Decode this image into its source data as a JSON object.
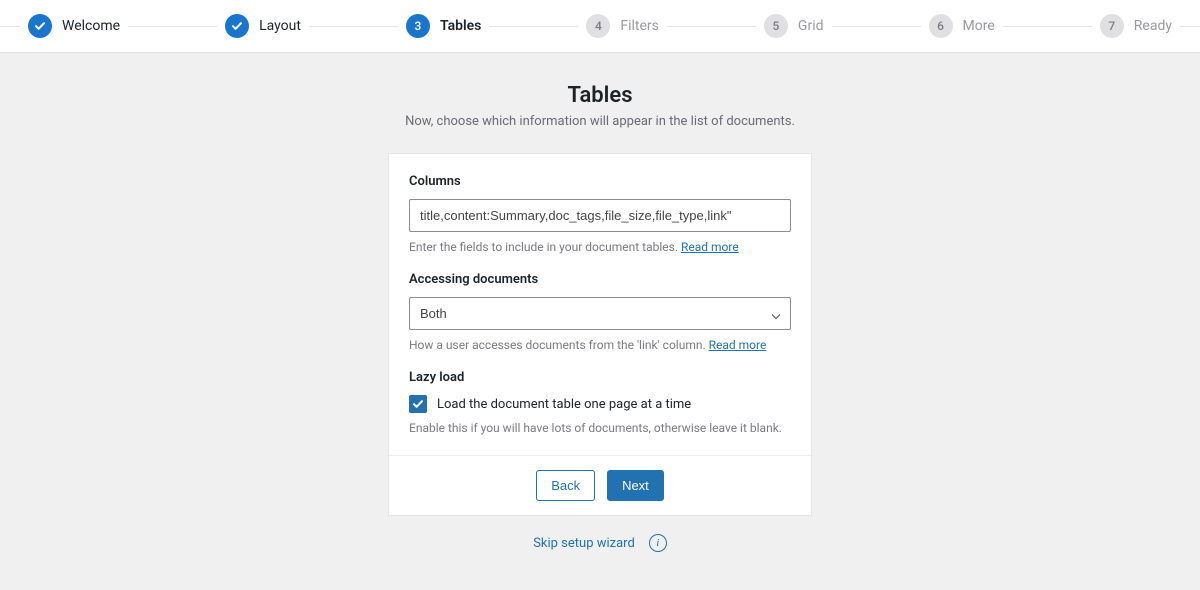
{
  "stepper": {
    "steps": [
      {
        "label": "Welcome",
        "state": "completed"
      },
      {
        "label": "Layout",
        "state": "completed"
      },
      {
        "label": "Tables",
        "state": "active",
        "num": "3"
      },
      {
        "label": "Filters",
        "state": "pending",
        "num": "4"
      },
      {
        "label": "Grid",
        "state": "pending",
        "num": "5"
      },
      {
        "label": "More",
        "state": "pending",
        "num": "6"
      },
      {
        "label": "Ready",
        "state": "pending",
        "num": "7"
      }
    ]
  },
  "heading": {
    "title": "Tables",
    "subtitle": "Now, choose which information will appear in the list of documents."
  },
  "form": {
    "columns": {
      "label": "Columns",
      "value": "title,content:Summary,doc_tags,file_size,file_type,link\"",
      "help_text": "Enter the fields to include in your document tables. ",
      "help_link": "Read more"
    },
    "accessing": {
      "label": "Accessing documents",
      "selected": "Both",
      "help_text": "How a user accesses documents from the 'link' column. ",
      "help_link": "Read more"
    },
    "lazy": {
      "label": "Lazy load",
      "checkbox_label": "Load the document table one page at a time",
      "checked": true,
      "help_text": "Enable this if you will have lots of documents, otherwise leave it blank."
    }
  },
  "buttons": {
    "back": "Back",
    "next": "Next"
  },
  "footer": {
    "skip": "Skip setup wizard",
    "info_glyph": "i"
  }
}
